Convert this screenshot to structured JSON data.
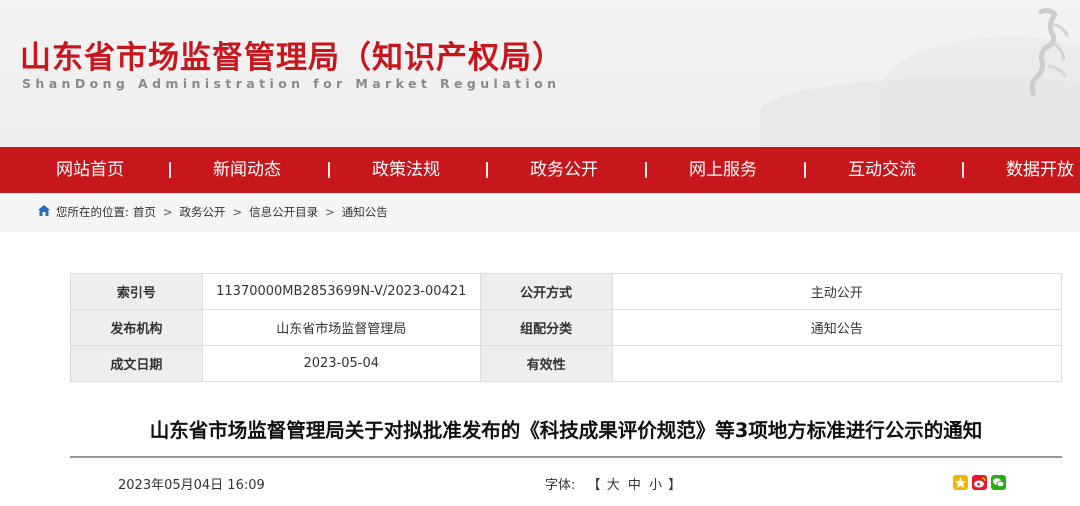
{
  "header": {
    "title": "山东省市场监督管理局（知识产权局）",
    "subtitle": "ShanDong Administration for Market Regulation"
  },
  "nav": {
    "items": [
      "网站首页",
      "新闻动态",
      "政策法规",
      "政务公开",
      "网上服务",
      "互动交流",
      "数据开放"
    ],
    "separator": "|"
  },
  "breadcrumb": {
    "prefix": "您所在的位置:",
    "items": [
      "首页",
      "政务公开",
      "信息公开目录",
      "通知公告"
    ],
    "arrow": ">"
  },
  "meta": {
    "rows": [
      {
        "k1": "索引号",
        "v1": "11370000MB2853699N-V/2023-00421",
        "k2": "公开方式",
        "v2": "主动公开"
      },
      {
        "k1": "发布机构",
        "v1": "山东省市场监督管理局",
        "k2": "组配分类",
        "v2": "通知公告"
      },
      {
        "k1": "成文日期",
        "v1": "2023-05-04",
        "k2": "有效性",
        "v2": ""
      }
    ]
  },
  "article": {
    "title": "山东省市场监督管理局关于对拟批准发布的《科技成果评价规范》等3项地方标准进行公示的通知",
    "datetime": "2023年05月04日 16:09",
    "font_label": "字体:",
    "font_open": "【",
    "font_sizes": [
      "大",
      "中",
      "小"
    ],
    "font_close": "】"
  },
  "colors": {
    "brand_red": "#c8161d",
    "crumb_bg": "#f5f5f5",
    "table_key_bg": "#eeeeee"
  },
  "icons": {
    "home": "home-icon",
    "share": [
      "qzone-share-icon",
      "weibo-share-icon",
      "wechat-share-icon"
    ]
  }
}
